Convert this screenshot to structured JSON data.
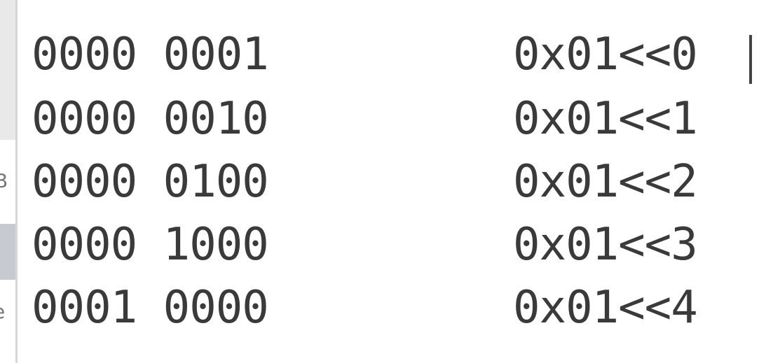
{
  "left_pane": {
    "partial_text_1": "B",
    "partial_text_2": "e"
  },
  "rows": [
    {
      "binary": "0000 0001",
      "expression": "0x01<<0"
    },
    {
      "binary": "0000 0010",
      "expression": "0x01<<1"
    },
    {
      "binary": "0000 0100",
      "expression": "0x01<<2"
    },
    {
      "binary": "0000 1000",
      "expression": "0x01<<3"
    },
    {
      "binary": "0001 0000",
      "expression": "0x01<<4"
    }
  ]
}
